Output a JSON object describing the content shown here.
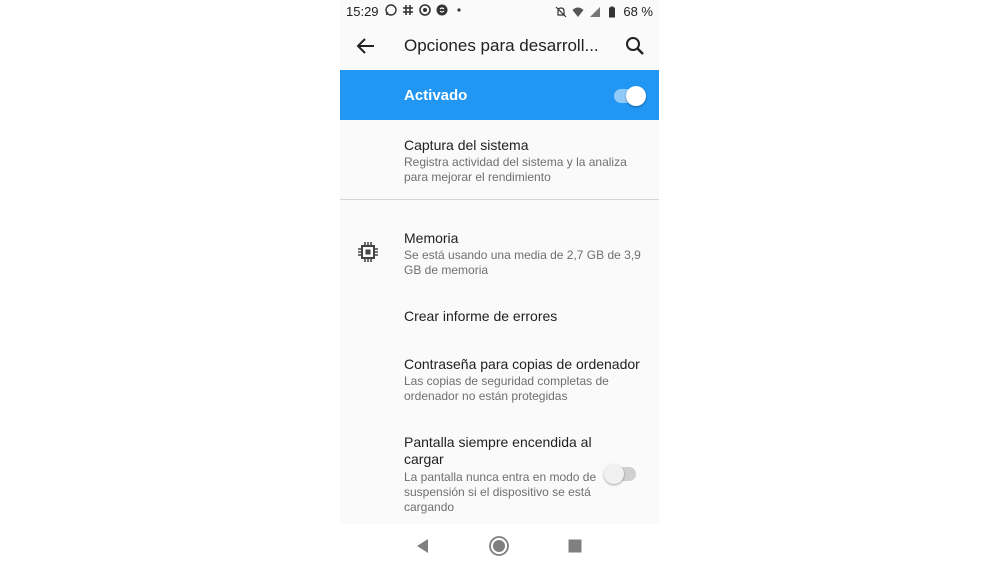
{
  "status_bar": {
    "time": "15:29",
    "battery": "68 %",
    "left_icons": [
      "whatsapp-icon",
      "slack-icon",
      "app-icon",
      "shazam-icon",
      "dot-icon"
    ],
    "right_icons": [
      "notifications-off-icon",
      "wifi-icon",
      "signal-icon",
      "battery-icon"
    ]
  },
  "app_bar": {
    "title": "Opciones para desarroll...",
    "back_icon": "arrow-back-icon",
    "search_icon": "search-icon"
  },
  "master_switch": {
    "label": "Activado",
    "enabled": true,
    "color": "#2196f3"
  },
  "preferences": [
    {
      "title": "Captura del sistema",
      "summary": "Registra actividad del sistema y la analiza para mejorar el rendimiento"
    },
    {
      "title": "Memoria",
      "summary": "Se está usando una media de 2,7 GB de 3,9 GB de memoria",
      "icon": "memory-chip-icon"
    },
    {
      "title": "Crear informe de errores",
      "summary": ""
    },
    {
      "title": "Contraseña para copias de ordenador",
      "summary": "Las copias de seguridad completas de ordenador no están protegidas"
    },
    {
      "title": "Pantalla siempre encendida al cargar",
      "summary": "La pantalla nunca entra en modo de suspensión si el dispositivo se está cargando",
      "switch_enabled": false
    }
  ],
  "nav_bar": {
    "buttons": [
      "back-triangle-icon",
      "home-circle-icon",
      "recents-square-icon"
    ]
  }
}
